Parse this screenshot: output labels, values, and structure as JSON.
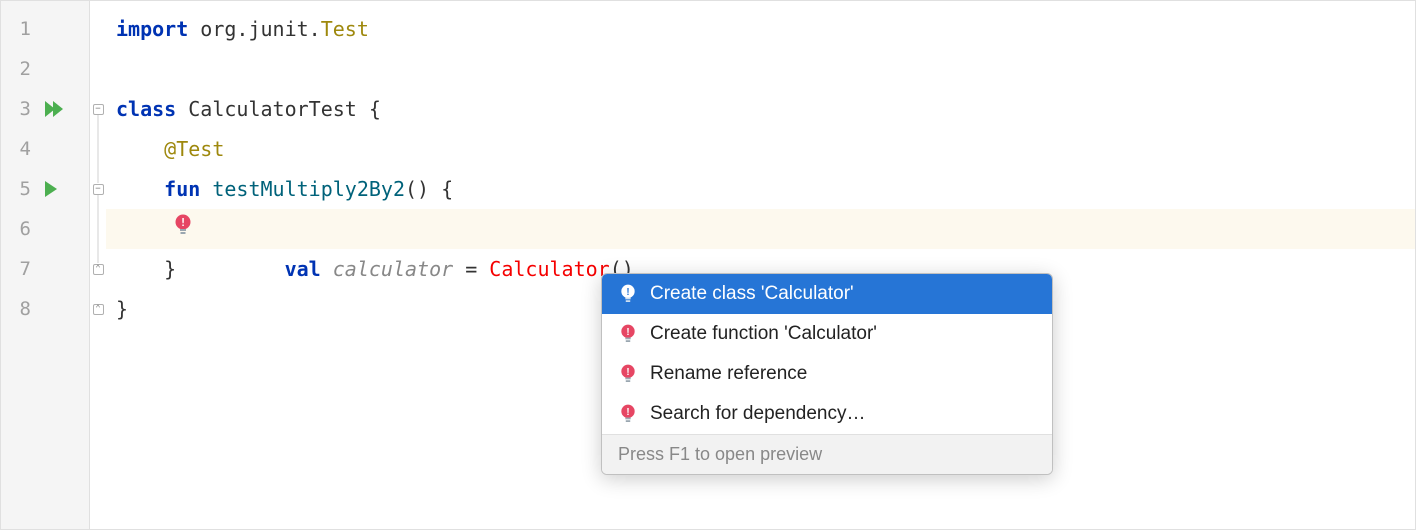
{
  "lines": {
    "count": 8,
    "numbers": [
      "1",
      "2",
      "3",
      "4",
      "5",
      "6",
      "7",
      "8"
    ]
  },
  "code": {
    "line1": {
      "kw": "import",
      "pkg": "org.junit.",
      "cls": "Test"
    },
    "line3": {
      "kw": "class",
      "name": "CalculatorTest",
      "brace": " {"
    },
    "line4": {
      "annotation": "@Test"
    },
    "line5": {
      "kw": "fun",
      "name": "testMultiply2By2",
      "parens": "() {"
    },
    "line6": {
      "kw": "val",
      "varname": "calculator",
      "eq": " = ",
      "err": "Calculator",
      "call": "()"
    },
    "line7": {
      "brace": "}"
    },
    "line8": {
      "brace": "}"
    }
  },
  "quickfix": {
    "items": [
      "Create class 'Calculator'",
      "Create function 'Calculator'",
      "Rename reference",
      "Search for dependency…"
    ],
    "footer": "Press F1 to open preview"
  }
}
